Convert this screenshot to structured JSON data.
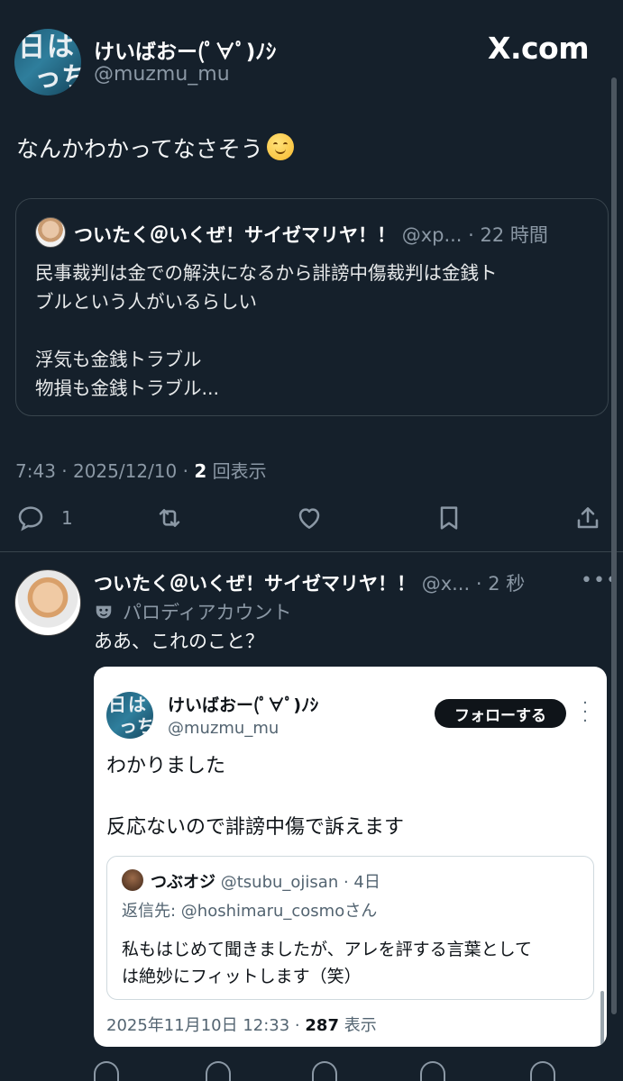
{
  "header": {
    "name": "けいばおー(ﾟ∀ﾟ)ﾉｼ",
    "handle": "@muzmu_mu",
    "site_logo": "X.com",
    "avatar_chars": [
      "日",
      "は",
      "っ",
      "ち"
    ]
  },
  "post": {
    "text": "なんかわかってなさそう",
    "emoji": "smiling-face-icon",
    "quote": {
      "name": "ついたく＠いくぜ！サイゼマリヤ！！",
      "handle": "@xp...",
      "time": "· 22 時間",
      "lines": [
        "民事裁判は金での解決になるから誹謗中傷裁判は金銭ト",
        "ブルという人がいるらしい",
        "",
        "浮気も金銭トラブル",
        "物損も金銭トラブル..."
      ]
    },
    "timestamp": "7:43 · 2025/12/10 · ",
    "views_count": "2",
    "views_label": " 回表示",
    "actions": {
      "reply_count": "1",
      "icons": [
        "reply-icon",
        "retweet-icon",
        "like-icon",
        "bookmark-icon",
        "share-icon"
      ]
    }
  },
  "reply": {
    "name": "ついたく＠いくぜ！サイゼマリヤ！！",
    "handle": "@x...",
    "time": "· 2 秒",
    "more": "•••",
    "badge": "パロディアカウント",
    "text": "ああ、これのこと？",
    "screenshot": {
      "name": "けいばおー(ﾟ∀ﾟ)ﾉｼ",
      "handle": "@muzmu_mu",
      "follow_label": "フォローする",
      "avatar_chars": [
        "日",
        "は",
        "っ",
        "ち"
      ],
      "body": [
        "わかりました",
        "",
        "反応ないので誹謗中傷で訴えます"
      ],
      "quote": {
        "name": "つぶオジ",
        "handle": "@tsubu_ojisan",
        "time": "· 4日",
        "reply_prefix": "返信先: ",
        "reply_to": "@hoshimaru_cosmo",
        "reply_suffix": "さん",
        "lines": [
          "私もはじめて聞きましたが、アレを評する言葉として",
          "は絶妙にフィットします（笑）"
        ]
      },
      "footer_time": "2025年11月10日 12:33 · ",
      "footer_views": "287",
      "footer_label": " 表示"
    }
  },
  "colors": {
    "background": "#15202b",
    "text": "#e7e9ea",
    "muted": "#8b98a5",
    "border": "#38444d"
  }
}
